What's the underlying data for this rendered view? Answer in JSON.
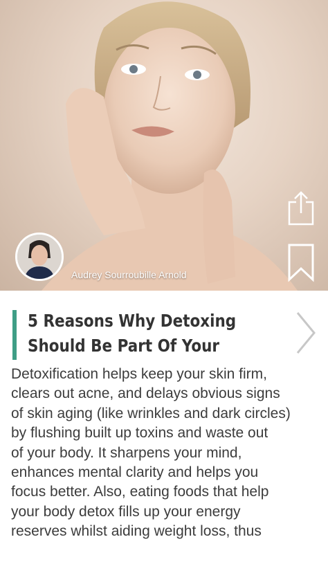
{
  "author": {
    "name": "Audrey Sourroubille Arnold"
  },
  "actions": {
    "share_icon": "share-icon",
    "bookmark_icon": "bookmark-icon",
    "next_icon": "chevron-right-icon"
  },
  "article": {
    "headline": "5 Reasons Why Detoxing Should Be Part Of Your",
    "body_lines": [
      "Detoxification helps keep your skin firm,",
      "clears out acne, and delays obvious signs",
      "of skin aging (like wrinkles and dark circles)",
      "by flushing built up toxins and waste out",
      "of your body. It sharpens your mind,",
      "enhances mental clarity and helps you",
      "focus better. Also, eating foods that help",
      "your body detox fills up your energy",
      "reserves whilst aiding weight loss, thus"
    ]
  },
  "colors": {
    "accent": "#3f9e86",
    "text": "#3c3c3c",
    "headline": "#333333"
  }
}
